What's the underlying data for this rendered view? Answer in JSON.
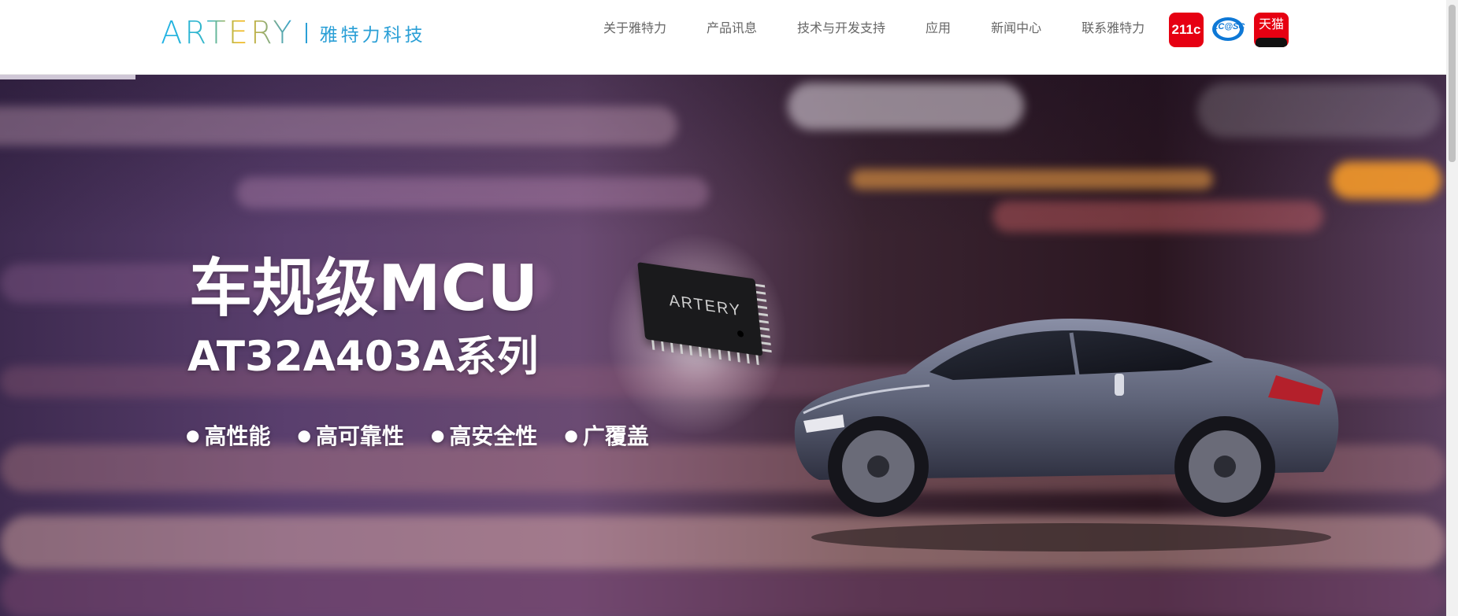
{
  "header": {
    "logo_text": "ARTERY",
    "logo_cn": "雅特力科技",
    "nav": [
      "关于雅特力",
      "产品讯息",
      "技术与开发支持",
      "应用",
      "新闻中心",
      "联系雅特力"
    ],
    "badges": [
      {
        "label": "211c",
        "icon": "211ic-logo-icon"
      },
      {
        "label": "LC@SC",
        "icon": "lcsc-logo-icon"
      },
      {
        "label": "天猫",
        "icon": "tmall-logo-icon"
      }
    ]
  },
  "hero": {
    "title": "车规级MCU",
    "subtitle": "AT32A403A系列",
    "features": [
      "高性能",
      "高可靠性",
      "高安全性",
      "广覆盖"
    ],
    "chip_logo": "ARTERY"
  },
  "colors": {
    "brand_blue": "#2a9fd6",
    "badge_red": "#e60012",
    "lcsc_blue": "#0e78d6"
  }
}
